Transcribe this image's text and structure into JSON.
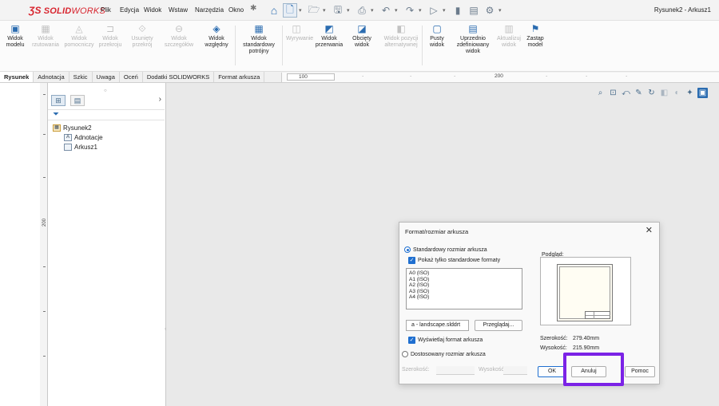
{
  "app": {
    "brand_ds": "ƷS",
    "brand_solid": "SOLID",
    "brand_works": "WORKS",
    "document_title": "Rysunek2 - Arkusz1"
  },
  "menu": [
    "Plik",
    "Edycja",
    "Widok",
    "Wstaw",
    "Narzędzia",
    "Okno"
  ],
  "ribbon": [
    {
      "label": "Widok modelu",
      "enabled": true,
      "icon": "model-view-icon"
    },
    {
      "label": "Widok rzutowania",
      "enabled": false,
      "icon": "projected-view-icon"
    },
    {
      "label": "Widok pomocniczy",
      "enabled": false,
      "icon": "auxiliary-view-icon"
    },
    {
      "label": "Widok przekroju",
      "enabled": false,
      "icon": "section-view-icon"
    },
    {
      "label": "Usunięty przekrój",
      "enabled": false,
      "icon": "removed-section-icon"
    },
    {
      "label": "Widok szczegółów",
      "enabled": false,
      "icon": "detail-view-icon"
    },
    {
      "label": "Widok względny",
      "enabled": true,
      "icon": "relative-view-icon"
    },
    {
      "label": "Widok standardowy potrójny",
      "enabled": true,
      "icon": "standard-3-view-icon"
    },
    {
      "label": "Wyrywanie",
      "enabled": false,
      "icon": "break-out-icon"
    },
    {
      "label": "Widok przerwania",
      "enabled": true,
      "icon": "break-view-icon"
    },
    {
      "label": "Obcięty widok",
      "enabled": true,
      "icon": "crop-view-icon"
    },
    {
      "label": "Widok pozycji alternatywnej",
      "enabled": false,
      "icon": "alternate-position-icon"
    },
    {
      "label": "Pusty widok",
      "enabled": true,
      "icon": "empty-view-icon"
    },
    {
      "label": "Uprzednio zdefiniowany widok",
      "enabled": true,
      "icon": "predefined-view-icon"
    },
    {
      "label": "Aktualizuj widok",
      "enabled": false,
      "icon": "update-view-icon"
    },
    {
      "label": "Zastąp model",
      "enabled": true,
      "icon": "replace-model-icon"
    }
  ],
  "tabs": [
    {
      "label": "Rysunek",
      "active": true
    },
    {
      "label": "Adnotacja",
      "active": false
    },
    {
      "label": "Szkic",
      "active": false
    },
    {
      "label": "Uwaga",
      "active": false
    },
    {
      "label": "Oceń",
      "active": false
    },
    {
      "label": "Dodatki SOLIDWORKS",
      "active": false
    },
    {
      "label": "Format arkusza",
      "active": false
    }
  ],
  "rulers": {
    "top_marks": [
      "100",
      "200"
    ],
    "left_mark": "200"
  },
  "feature_tree": {
    "root": "Rysunek2",
    "children": [
      "Adnotacje",
      "Arkusz1"
    ]
  },
  "dialog": {
    "title": "Format/rozmiar arkusza",
    "close_glyph": "✕",
    "standard_radio_label": "Standardowy rozmiar arkusza",
    "show_standard_label": "Pokaż tylko standardowe formaty",
    "formats": [
      "A0 (ISO)",
      "A1 (ISO)",
      "A2 (ISO)",
      "A3 (ISO)",
      "A4 (ISO)"
    ],
    "file_value": "a - landscape.slddrt",
    "browse_label": "Przeglądaj...",
    "display_format_label": "Wyświetlaj format arkusza",
    "custom_radio_label": "Dostosowany rozmiar arkusza",
    "width_label": "Szerokość:",
    "height_label": "Wysokość:",
    "preview_label": "Podgląd:",
    "size_width_label": "Szerokość:",
    "size_width_value": "279.40mm",
    "size_height_label": "Wysokość:",
    "size_height_value": "215.90mm",
    "ok_label": "OK",
    "cancel_label": "Anuluj",
    "help_label": "Pomoc"
  },
  "colors": {
    "brand": "#d8252f",
    "accent": "#1f6fd0",
    "highlight": "#7b22e6"
  }
}
